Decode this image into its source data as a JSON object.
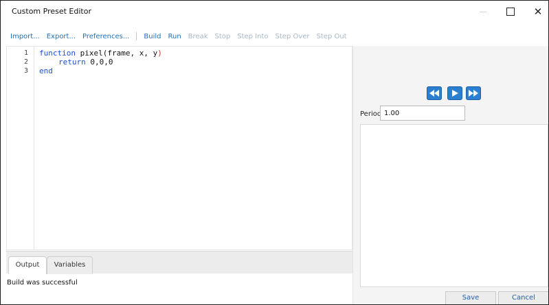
{
  "window": {
    "title": "Custom Preset Editor",
    "controls": [
      "minimize",
      "maximize",
      "close"
    ],
    "close_glyph": "✕",
    "minimize_glyph": "—"
  },
  "toolbar": {
    "items": [
      {
        "label": "Import...",
        "enabled": true
      },
      {
        "label": "Export...",
        "enabled": true
      },
      {
        "label": "Preferences...",
        "enabled": true
      },
      {
        "label": "Build",
        "enabled": true
      },
      {
        "label": "Run",
        "enabled": true
      },
      {
        "label": "Break",
        "enabled": false
      },
      {
        "label": "Stop",
        "enabled": false
      },
      {
        "label": "Step Into",
        "enabled": false
      },
      {
        "label": "Step Over",
        "enabled": false
      },
      {
        "label": "Step Out",
        "enabled": false
      }
    ]
  },
  "editor": {
    "line_numbers": [
      "1",
      "2",
      "3"
    ],
    "lines": {
      "l1_kw": "function",
      "l1_name": " pixel",
      "l1_open": "(",
      "l1_args": "frame, x, y",
      "l1_close": ")",
      "l2_kw": "return",
      "l2_rest": " 0,0,0",
      "l3_kw": "end"
    }
  },
  "bottom_panel": {
    "tabs": [
      "Output",
      "Variables"
    ],
    "active_tab": "Output",
    "output_text": "Build was successful"
  },
  "playback": {
    "buttons": [
      "rewind-icon",
      "play-icon",
      "fast-forward-icon"
    ]
  },
  "period": {
    "label": "Period",
    "value": "1.00"
  },
  "actions": {
    "save_label": "Save",
    "cancel_label": "Cancel"
  },
  "colors": {
    "accent_blue": "#2b7fd1",
    "link_blue": "#1f6fb5",
    "disabled_gray": "#a8b8c6",
    "keyword_blue": "#1a4fd6"
  }
}
